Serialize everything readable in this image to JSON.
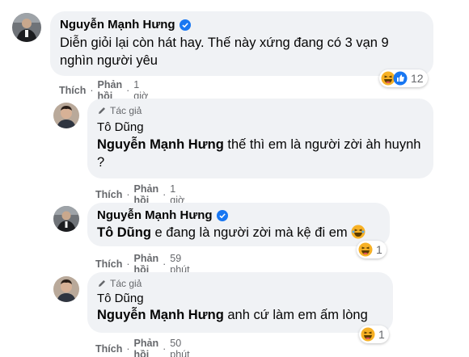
{
  "comments": [
    {
      "author": "Nguyễn Mạnh Hưng",
      "verified": true,
      "text": "Diễn giỏi lại còn hát hay. Thế này xứng đang có 3 vạn 9 nghìn người yêu",
      "actions": {
        "like": "Thích",
        "reply": "Phản hồi",
        "time": "1 giờ"
      },
      "reactions": {
        "icons": [
          "haha-icon",
          "like-icon"
        ],
        "count": "12"
      }
    },
    {
      "author_tag": "Tác giả",
      "author": "Tô Dũng",
      "mention": "Nguyễn Mạnh Hưng",
      "text": "thế thì em là người zời àh huynh ?",
      "actions": {
        "like": "Thích",
        "reply": "Phản hồi",
        "time": "1 giờ"
      }
    },
    {
      "author": "Nguyễn Mạnh Hưng",
      "verified": true,
      "mention": "Tô Dũng",
      "text": "e đang là người zời mà kệ đi em",
      "actions": {
        "like": "Thích",
        "reply": "Phản hồi",
        "time": "59 phút"
      },
      "reactions": {
        "icons": [
          "haha-icon"
        ],
        "count": "1"
      }
    },
    {
      "author_tag": "Tác giả",
      "author": "Tô Dũng",
      "mention": "Nguyễn Mạnh Hưng",
      "text": "anh cứ làm em ấm lòng",
      "actions": {
        "like": "Thích",
        "reply": "Phản hồi",
        "time": "50 phút"
      },
      "reactions": {
        "icons": [
          "haha-icon"
        ],
        "count": "1"
      }
    }
  ],
  "colors": {
    "bubble": "#f0f2f5",
    "verified": "#1877f2",
    "meta": "#65676b",
    "haha": "#f7b125"
  }
}
